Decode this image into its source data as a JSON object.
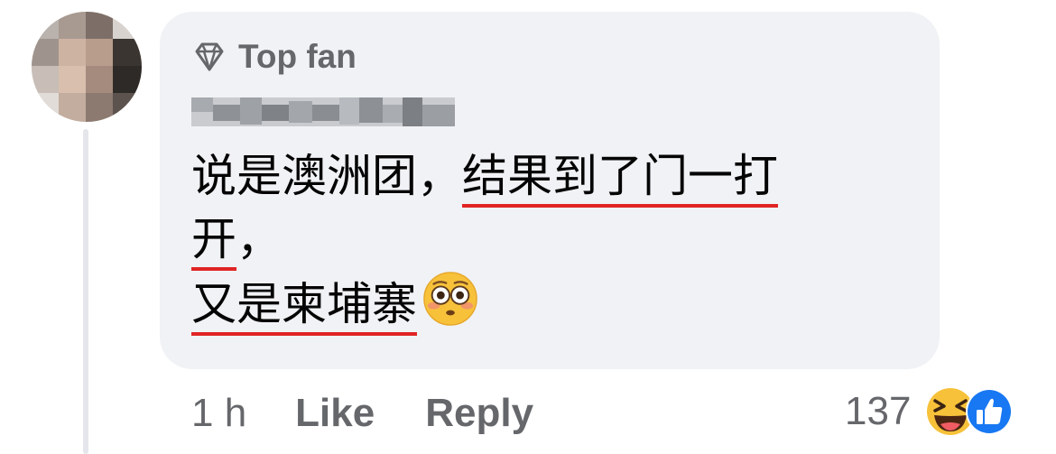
{
  "comment": {
    "badge_label": "Top fan",
    "text_lines": [
      {
        "plain": "说是澳洲团，",
        "underlined": "结果到了门一打"
      },
      {
        "plain": "",
        "underlined": "开",
        "trailing": "，"
      },
      {
        "plain": "",
        "underlined": "又是柬埔寨",
        "emoji": "flushed-face"
      }
    ]
  },
  "actions": {
    "time": "1 h",
    "like_label": "Like",
    "reply_label": "Reply"
  },
  "reactions": {
    "count": "137",
    "icons": [
      "laughing-face-icon",
      "thumbs-up-icon"
    ],
    "like_color": "#1877f2"
  },
  "colors": {
    "bubble": "#f0f2f5",
    "secondary_text": "#65676b",
    "underline": "#e02424"
  }
}
